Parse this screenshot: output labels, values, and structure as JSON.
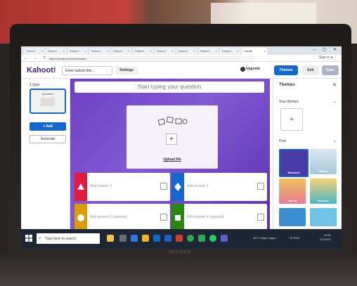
{
  "browser": {
    "tabs": [
      {
        "label": "Kahoot",
        "active": false
      },
      {
        "label": "Kahoot",
        "active": false
      },
      {
        "label": "Kahoot",
        "active": false
      },
      {
        "label": "Kahoot",
        "active": false
      },
      {
        "label": "Kahoot",
        "active": false
      },
      {
        "label": "Kahoot",
        "active": false
      },
      {
        "label": "Kahoot",
        "active": false
      },
      {
        "label": "Kahoot",
        "active": false
      },
      {
        "label": "Kahoot",
        "active": false
      },
      {
        "label": "Kahoot",
        "active": false
      },
      {
        "label": "Create",
        "active": true
      }
    ],
    "url": "https://create.kahoot.it/creator",
    "nav_icons": "← → ↻",
    "profile": "Sign in ● ⋮",
    "window_controls": "– ▢ ✕"
  },
  "header": {
    "logo": "Kahoot!",
    "title_placeholder": "Enter kahoot title...",
    "settings_label": "Settings",
    "upgrade_label": "Upgrade",
    "themes_label": "Themes",
    "exit_label": "Exit",
    "save_label": "Save"
  },
  "sidebar": {
    "slide_label": "1 Quiz",
    "thumb_label": "Question",
    "add_label": "+ Add",
    "generate_label": "Generate"
  },
  "editor": {
    "question_placeholder": "Start typing your question",
    "media_plus": "+",
    "upload_label": "Upload file",
    "answers": [
      {
        "label": "Add answer 1",
        "color": "#e21b3c",
        "shape": "triangle"
      },
      {
        "label": "Add answer 2",
        "color": "#1368ce",
        "shape": "diamond"
      },
      {
        "label": "Add answer 3 (optional)",
        "color": "#d89e00",
        "shape": "circle"
      },
      {
        "label": "Add answer 4 (optional)",
        "color": "#26890c",
        "shape": "square"
      }
    ]
  },
  "themes_panel": {
    "title": "Themes",
    "close": "✕",
    "your_themes": "Your themes",
    "add_theme": "+",
    "free_label": "Free",
    "themes": [
      {
        "name": "Standard",
        "color": "#4a3aa8",
        "selected": true
      },
      {
        "name": "Winter",
        "color": "#a8c8dc",
        "selected": false
      },
      {
        "name": "Spring",
        "color": "#e77a9a",
        "selected": false
      },
      {
        "name": "Summer",
        "color": "#47b7c9",
        "selected": false
      }
    ]
  },
  "taskbar": {
    "search_placeholder": "Type here to search",
    "weather": "28°C Hujan ringan",
    "tray": "^ ⊡ ENG",
    "time": "10:55",
    "date": "2/1/2023"
  },
  "laptop_brand": "lenovo",
  "colors": {
    "kahoot_purple": "#46178f",
    "primary_blue": "#1368ce"
  }
}
